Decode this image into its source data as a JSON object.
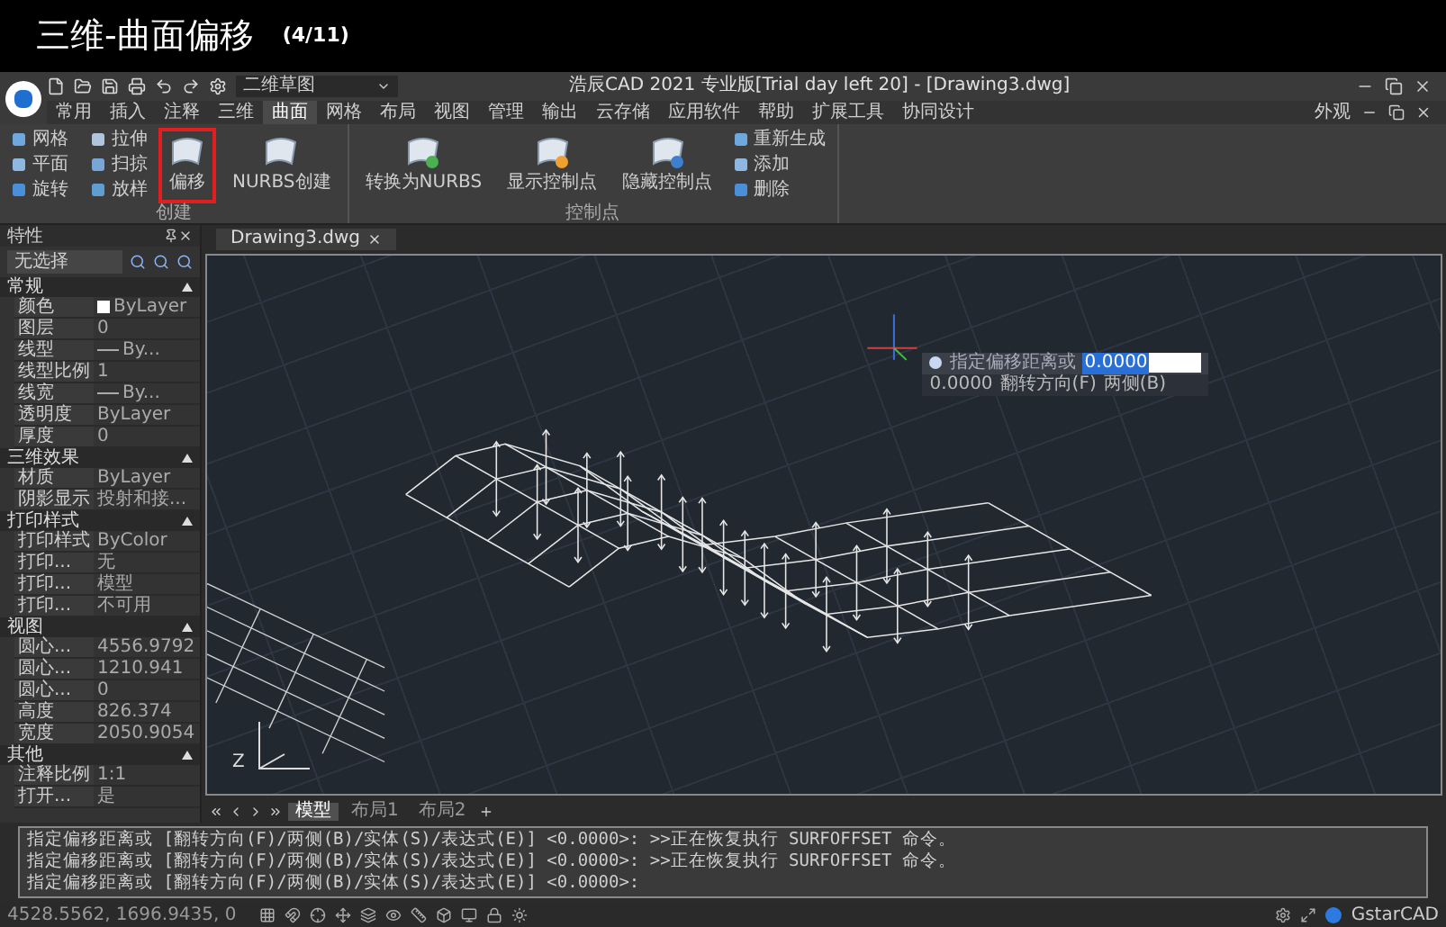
{
  "slide": {
    "title": "三维-曲面偏移",
    "counter": "(4/11)"
  },
  "app": {
    "workspace": "二维草图",
    "title": "浩辰CAD 2021 专业版[Trial day left 20] - [Drawing3.dwg]",
    "appearance": "外观",
    "menu": [
      {
        "label": "常用",
        "selected": false
      },
      {
        "label": "插入",
        "selected": false
      },
      {
        "label": "注释",
        "selected": false
      },
      {
        "label": "三维",
        "selected": false
      },
      {
        "label": "曲面",
        "selected": true
      },
      {
        "label": "网格",
        "selected": false
      },
      {
        "label": "布局",
        "selected": false
      },
      {
        "label": "视图",
        "selected": false
      },
      {
        "label": "管理",
        "selected": false
      },
      {
        "label": "输出",
        "selected": false
      },
      {
        "label": "云存储",
        "selected": false
      },
      {
        "label": "应用软件",
        "selected": false
      },
      {
        "label": "帮助",
        "selected": false
      },
      {
        "label": "扩展工具",
        "selected": false
      },
      {
        "label": "协同设计",
        "selected": false
      }
    ]
  },
  "ribbon": {
    "groups": [
      {
        "label": "创建",
        "tools": [
          {
            "kind": "small",
            "labels": [
              "网格",
              "平面",
              "旋转",
              "拉伸",
              "扫掠",
              "放样"
            ]
          },
          {
            "kind": "large",
            "label": "偏移",
            "highlighted": true
          },
          {
            "kind": "large",
            "label": "NURBS创建",
            "highlighted": false
          }
        ]
      },
      {
        "label": "控制点",
        "tools": [
          {
            "kind": "large",
            "label": "转换为NURBS",
            "highlighted": false
          },
          {
            "kind": "large",
            "label": "显示控制点",
            "highlighted": false
          },
          {
            "kind": "large",
            "label": "隐藏控制点",
            "highlighted": false
          },
          {
            "kind": "small",
            "labels": [
              "重新生成",
              "添加",
              "删除"
            ]
          }
        ]
      }
    ]
  },
  "properties": {
    "title": "特性",
    "selection": "无选择",
    "sections": [
      {
        "title": "常规",
        "expanded": true,
        "rows": [
          {
            "kind": "color",
            "label": "颜色",
            "value": "ByLayer"
          },
          {
            "kind": "text",
            "label": "图层",
            "value": "0"
          },
          {
            "kind": "line",
            "label": "线型",
            "value": "By..."
          },
          {
            "kind": "text",
            "label": "线型比例",
            "value": "1"
          },
          {
            "kind": "line",
            "label": "线宽",
            "value": "By..."
          },
          {
            "kind": "text",
            "label": "透明度",
            "value": "ByLayer"
          },
          {
            "kind": "text",
            "label": "厚度",
            "value": "0"
          }
        ]
      },
      {
        "title": "三维效果",
        "expanded": true,
        "rows": [
          {
            "kind": "text",
            "label": "材质",
            "value": "ByLayer"
          },
          {
            "kind": "text",
            "label": "阴影显示",
            "value": "投射和接..."
          }
        ]
      },
      {
        "title": "打印样式",
        "expanded": true,
        "rows": [
          {
            "kind": "text",
            "label": "打印样式",
            "value": "ByColor"
          },
          {
            "kind": "text",
            "label": "打印...",
            "value": "无"
          },
          {
            "kind": "text",
            "label": "打印...",
            "value": "模型"
          },
          {
            "kind": "text",
            "label": "打印...",
            "value": "不可用"
          }
        ]
      },
      {
        "title": "视图",
        "expanded": true,
        "rows": [
          {
            "kind": "text",
            "label": "圆心...",
            "value": "4556.9792"
          },
          {
            "kind": "text",
            "label": "圆心...",
            "value": "1210.941"
          },
          {
            "kind": "text",
            "label": "圆心...",
            "value": "0"
          },
          {
            "kind": "text",
            "label": "高度",
            "value": "826.374"
          },
          {
            "kind": "text",
            "label": "宽度",
            "value": "2050.9054"
          }
        ]
      },
      {
        "title": "其他",
        "expanded": true,
        "rows": [
          {
            "kind": "text",
            "label": "注释比例",
            "value": "1:1"
          },
          {
            "kind": "text",
            "label": "打开...",
            "value": "是"
          }
        ]
      }
    ]
  },
  "document_tab": "Drawing3.dwg",
  "prompt": {
    "label": "指定偏移距离或",
    "value": "0.0000",
    "value_selected": true,
    "current": "0.0000",
    "options": [
      "翻转方向(F)",
      "两侧(B)"
    ]
  },
  "ucs_label": "Z",
  "layout_tabs": [
    {
      "label": "模型",
      "selected": true
    },
    {
      "label": "布局1",
      "selected": false
    },
    {
      "label": "布局2",
      "selected": false
    }
  ],
  "command_lines": [
    "指定偏移距离或 [翻转方向(F)/两侧(B)/实体(S)/表达式(E)] <0.0000>: >>正在恢复执行 SURFOFFSET 命令。",
    "指定偏移距离或 [翻转方向(F)/两侧(B)/实体(S)/表达式(E)] <0.0000>: >>正在恢复执行 SURFOFFSET 命令。",
    "指定偏移距离或 [翻转方向(F)/两侧(B)/实体(S)/表达式(E)] <0.0000>:"
  ],
  "status": {
    "coords": "4528.5562, 1696.9435, 0",
    "brand": "GstarCAD"
  }
}
